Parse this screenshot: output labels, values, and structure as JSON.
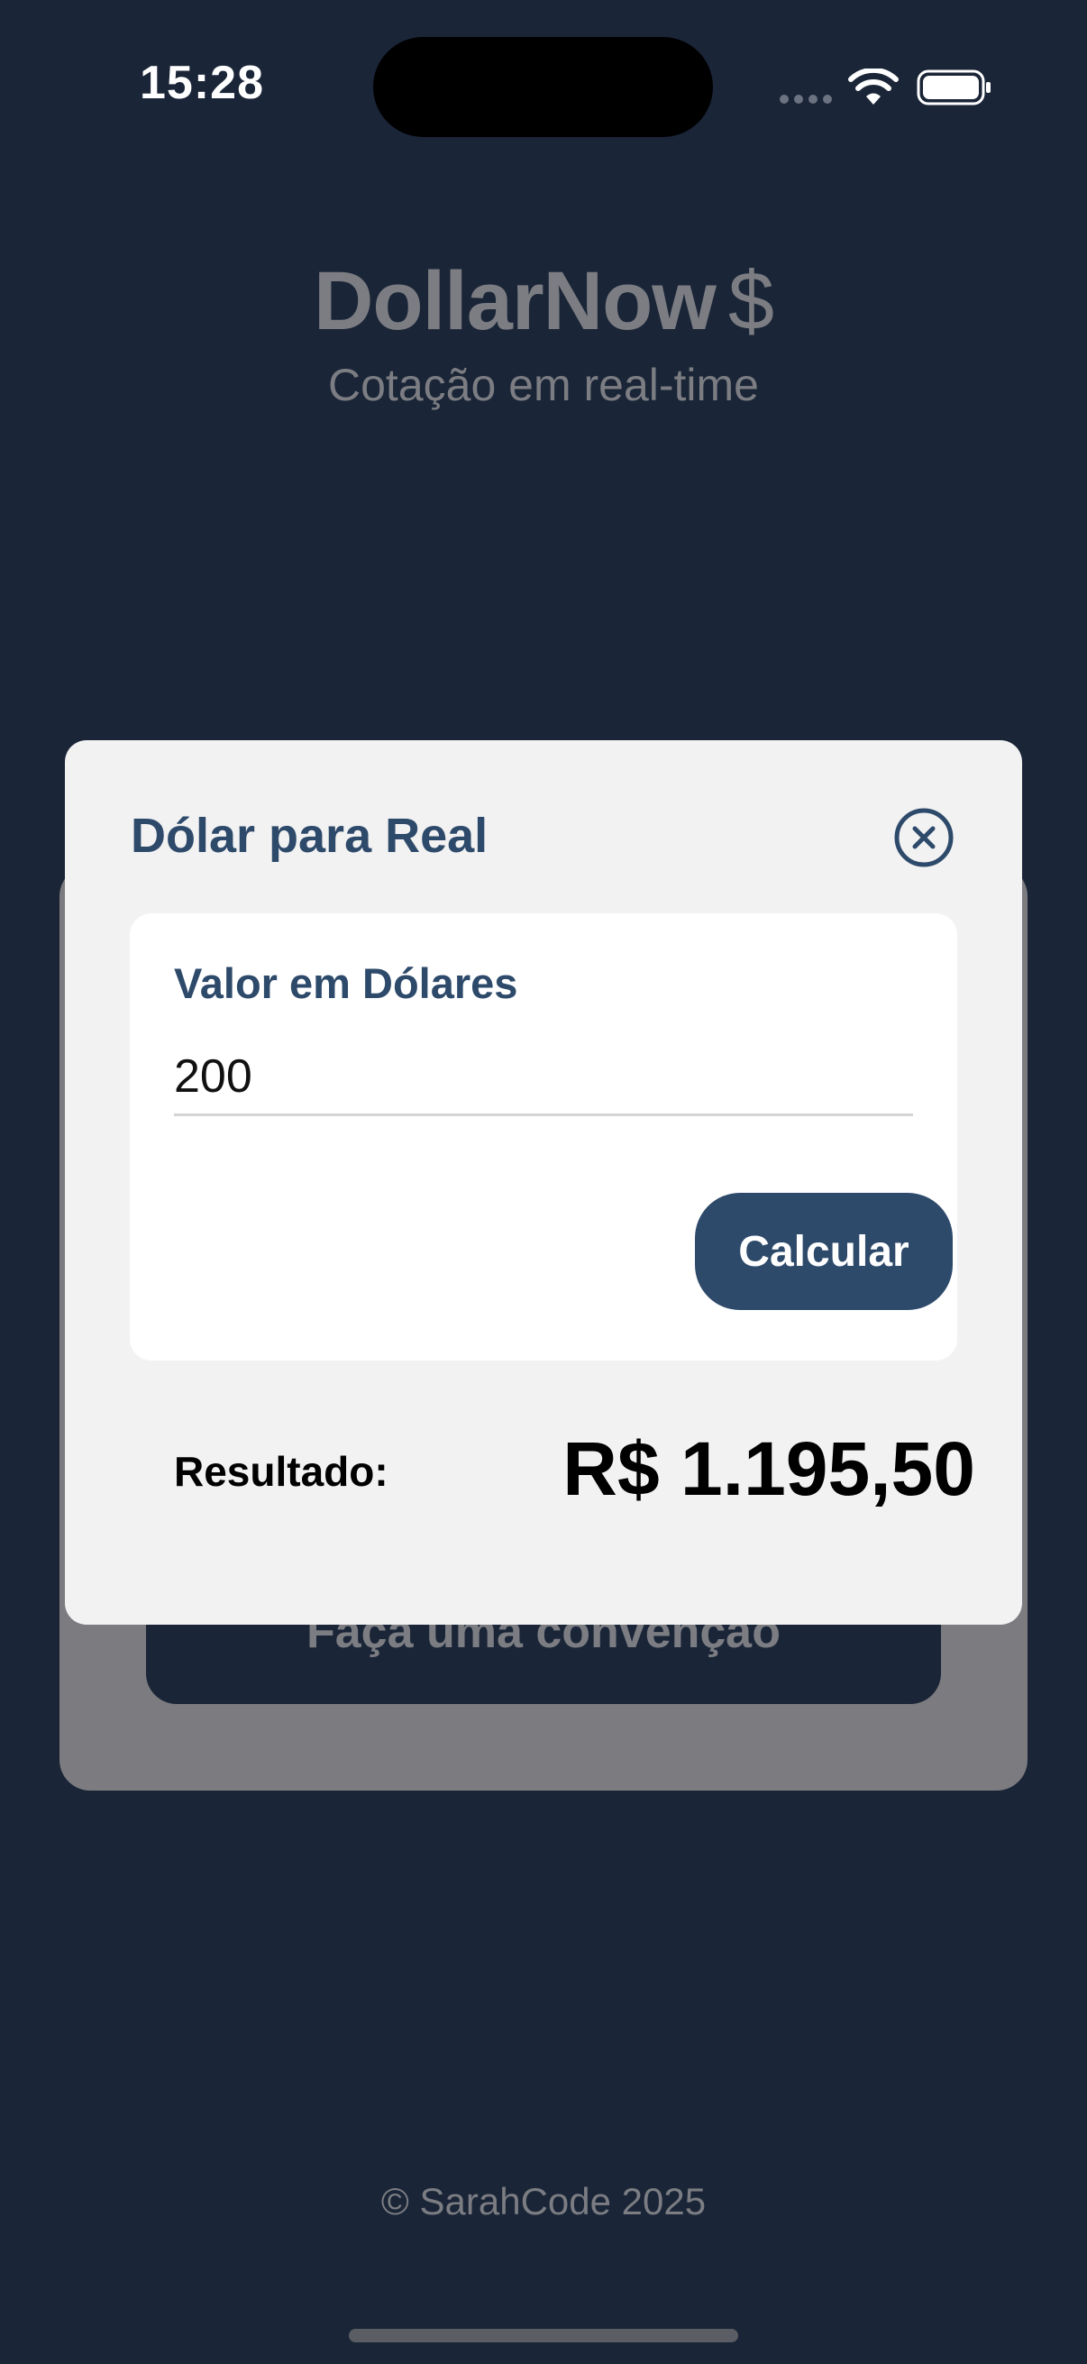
{
  "status_bar": {
    "time": "15:28",
    "icons": [
      "signal-icon",
      "wifi-icon",
      "battery-icon"
    ]
  },
  "header": {
    "app_name": "DollarNow",
    "currency_symbol": "$",
    "subtitle": "Cotação em real-time"
  },
  "background_card": {
    "button_label": "Faça uma convenção"
  },
  "modal": {
    "title": "Dólar para Real",
    "close_icon": "close-circle-icon",
    "input_label": "Valor em Dólares",
    "input_value": "200",
    "calculate_label": "Calcular",
    "result_label": "Resultado:",
    "result_value": "R$ 1.195,50"
  },
  "footer": {
    "copyright": "© SarahCode 2025"
  },
  "colors": {
    "background": "#1a2537",
    "accent": "#2e4a6b",
    "modal_surface": "#f2f2f2",
    "muted_text": "#7b7d82"
  }
}
